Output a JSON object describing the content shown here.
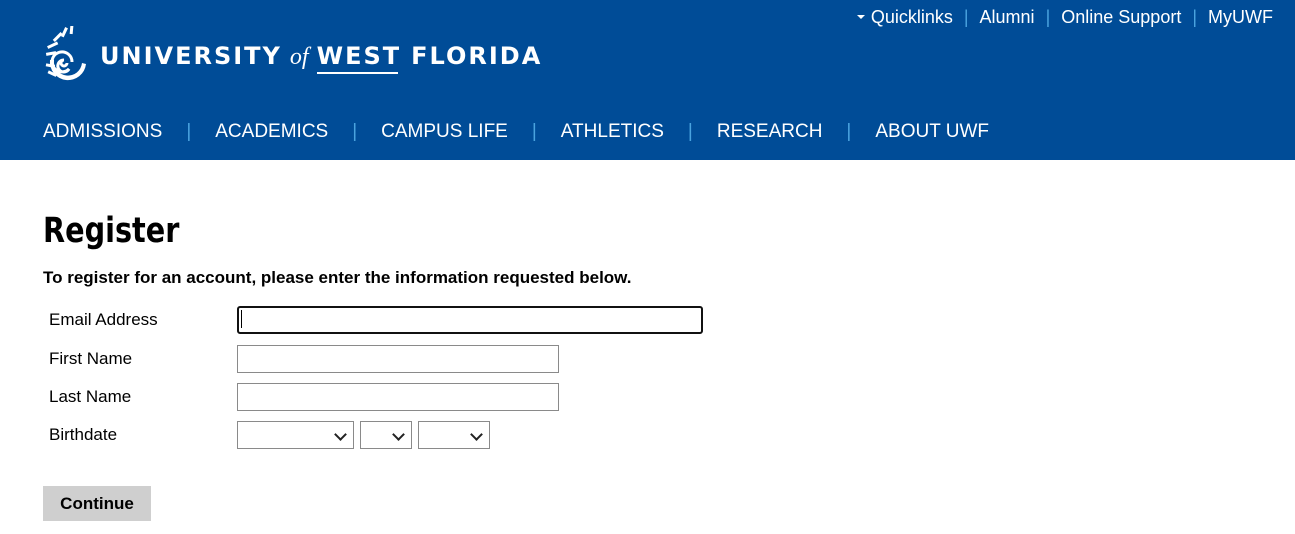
{
  "header": {
    "logo": {
      "word1": "UNIVERSITY",
      "word2": "of",
      "word3": "WEST",
      "word4": "FLORIDA"
    },
    "utility_links": [
      "Quicklinks",
      "Alumni",
      "Online Support",
      "MyUWF"
    ],
    "nav_items": [
      "ADMISSIONS",
      "ACADEMICS",
      "CAMPUS LIFE",
      "ATHLETICS",
      "RESEARCH",
      "ABOUT UWF"
    ]
  },
  "colors": {
    "header_bg": "#004c97",
    "separator": "#4aa3df",
    "button_bg": "#cfcfcf"
  },
  "page": {
    "title": "Register",
    "intro": "To register for an account, please enter the information requested below."
  },
  "form": {
    "email_label": "Email Address",
    "email_value": "",
    "first_name_label": "First Name",
    "first_name_value": "",
    "last_name_label": "Last Name",
    "last_name_value": "",
    "birthdate_label": "Birthdate",
    "birth_month": "",
    "birth_day": "",
    "birth_year": "",
    "continue_label": "Continue"
  },
  "icons": {
    "quicklinks_caret": "caret-down-icon",
    "select_chevron": "chevron-down-icon",
    "logo": "nautilus-shell-logo"
  }
}
